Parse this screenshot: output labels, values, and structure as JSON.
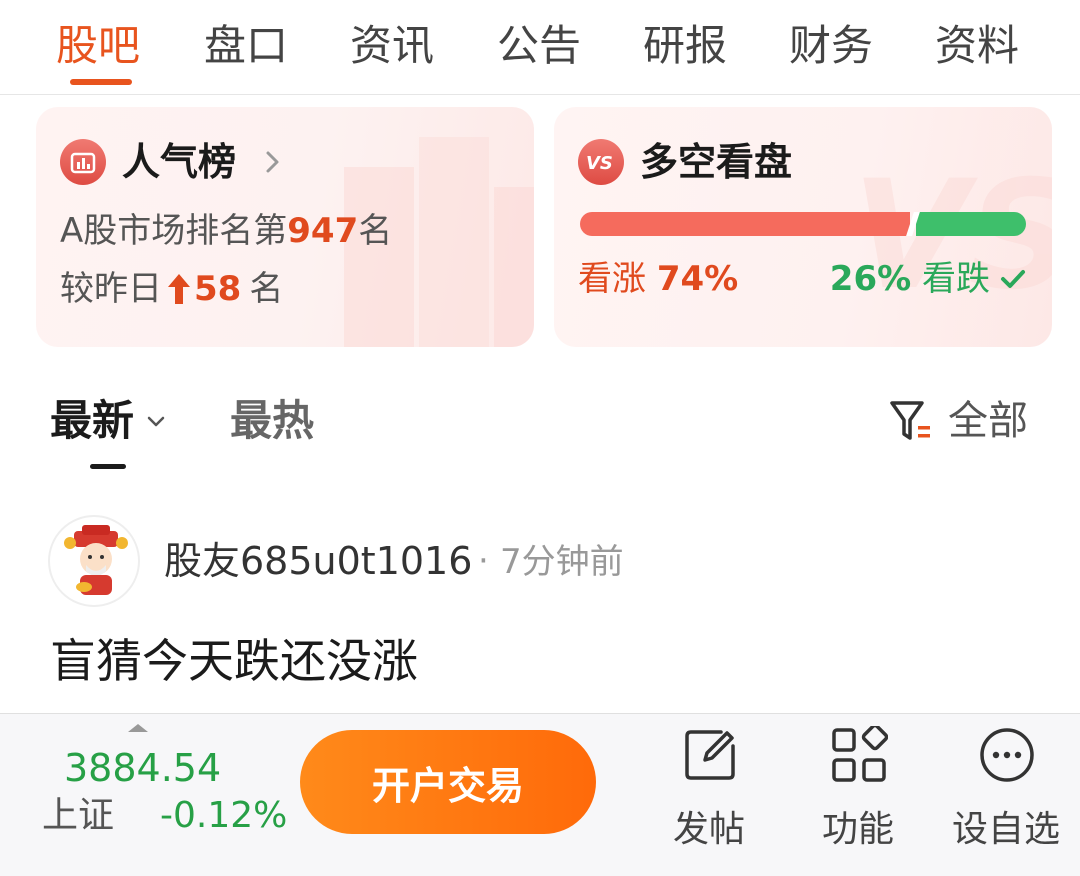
{
  "top_tabs": [
    {
      "label": "股吧",
      "active": true
    },
    {
      "label": "盘口"
    },
    {
      "label": "资讯"
    },
    {
      "label": "公告"
    },
    {
      "label": "研报"
    },
    {
      "label": "财务"
    },
    {
      "label": "资料"
    }
  ],
  "popularity": {
    "title": "人气榜",
    "rank_prefix": "A股市场排名第",
    "rank": "947",
    "rank_suffix": "名",
    "change_prefix": "较昨日",
    "change": "58",
    "change_suffix": "名",
    "icon": "bar-chart-icon"
  },
  "sentiment": {
    "title": "多空看盘",
    "bull_label": "看涨",
    "bull_pct": "74%",
    "bear_label": "看跌",
    "bear_pct": "26%",
    "bull_fraction": 0.74,
    "icon": "vs-icon",
    "colors": {
      "bull": "#f56b5d",
      "bear": "#3ebf6b"
    }
  },
  "sort": {
    "latest": "最新",
    "hot": "最热",
    "filter": "全部"
  },
  "post": {
    "author": "股友685u0t1016",
    "separator": "·",
    "time": "7分钟前",
    "content": "盲猜今天跌还没涨"
  },
  "bottom_bar": {
    "index_value": "3884.54",
    "index_name": "上证",
    "index_change": "-0.12%",
    "trade_button": "开户交易",
    "actions": [
      {
        "label": "发帖",
        "icon": "edit-icon"
      },
      {
        "label": "功能",
        "icon": "grid-icon"
      },
      {
        "label": "设自选",
        "icon": "more-icon"
      }
    ]
  },
  "colors": {
    "accent": "#e8541e",
    "index_green": "#27a046",
    "trade_button": "#ff7a12"
  }
}
